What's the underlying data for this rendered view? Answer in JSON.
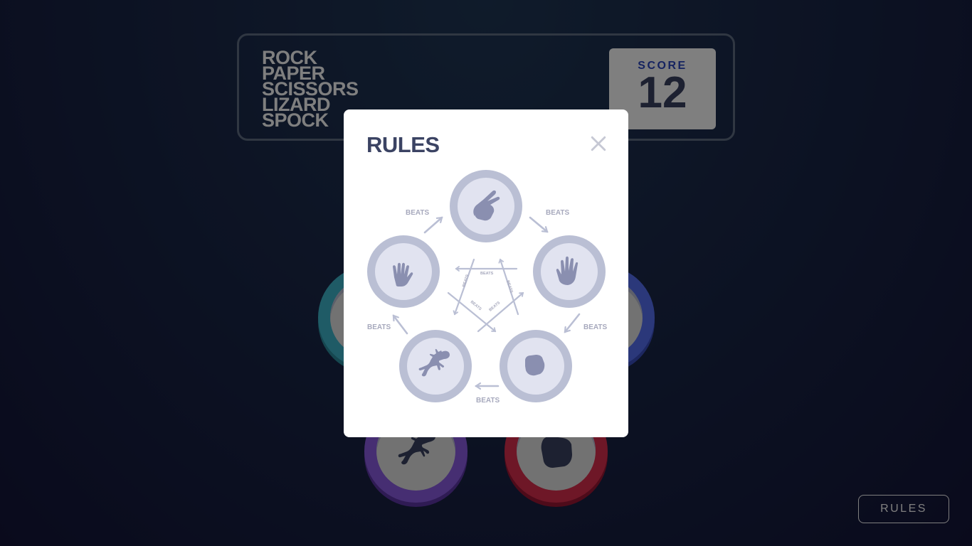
{
  "header": {
    "title_lines": [
      "ROCK",
      "PAPER",
      "SCISSORS",
      "LIZARD",
      "SPOCK"
    ],
    "score_label": "SCORE",
    "score_value": "12"
  },
  "rules_button": {
    "label": "RULES"
  },
  "modal": {
    "title": "RULES",
    "close_icon": "close-icon",
    "beats_label": "BEATS",
    "diagram_nodes": [
      {
        "name": "scissors",
        "icon": "scissors-icon"
      },
      {
        "name": "paper",
        "icon": "paper-icon"
      },
      {
        "name": "rock",
        "icon": "rock-icon"
      },
      {
        "name": "lizard",
        "icon": "lizard-icon"
      },
      {
        "name": "spock",
        "icon": "spock-icon"
      }
    ]
  },
  "tokens": [
    {
      "name": "spock",
      "color": "#3fb7cd"
    },
    {
      "name": "paper",
      "color": "#5671f5"
    },
    {
      "name": "lizard",
      "color": "#8c5de5"
    },
    {
      "name": "rock",
      "color": "#dc2e4e"
    }
  ],
  "colors": {
    "dark_text": "#3b4363",
    "score_text": "#2a46c0",
    "diagram_gray": "#babfd4",
    "diagram_icon": "#8a8fb0"
  }
}
